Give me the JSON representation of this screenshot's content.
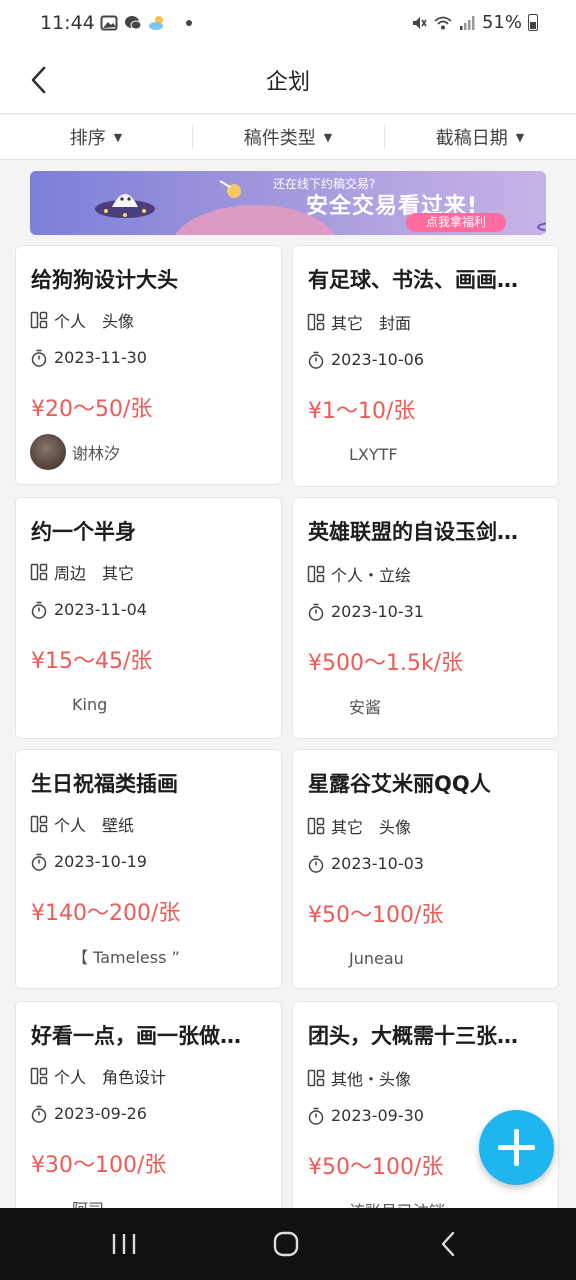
{
  "status_bar": {
    "time": "11:44",
    "battery": "51%",
    "icons": [
      "gallery-icon",
      "chat-icon",
      "weather-icon",
      "mute-icon",
      "wifi-icon",
      "signal-icon",
      "battery-icon"
    ]
  },
  "header": {
    "title": "企划",
    "back_icon": "chevron-left-icon"
  },
  "filters": [
    {
      "label": "排序"
    },
    {
      "label": "稿件类型"
    },
    {
      "label": "截稿日期"
    }
  ],
  "banner": {
    "line1": "还在线下约稿交易?",
    "line2": "安全交易看过来!",
    "cta": "点我拿福利"
  },
  "cards": [
    {
      "title": "给狗狗设计大头",
      "type1": "个人",
      "type2": "头像",
      "date": "2023-11-30",
      "price": "¥20～50/张",
      "author": "谢林汐",
      "has_avatar": true
    },
    {
      "title": "有足球、书法、画画…",
      "type1": "其它",
      "type2": "封面",
      "date": "2023-10-06",
      "price": "¥1～10/张",
      "author": "LXYTF",
      "has_avatar": false
    },
    {
      "title": "约一个半身",
      "type1": "周边",
      "type2": "其它",
      "date": "2023-11-04",
      "price": "¥15～45/张",
      "author": "King",
      "has_avatar": false
    },
    {
      "title": "英雄联盟的自设玉剑…",
      "type1": "个人・立绘",
      "type2": "",
      "date": "2023-10-31",
      "price": "¥500～1.5k/张",
      "author": "安酱",
      "has_avatar": false
    },
    {
      "title": "生日祝福类插画",
      "type1": "个人",
      "type2": "壁纸",
      "date": "2023-10-19",
      "price": "¥140～200/张",
      "author": "【 Tameless ”",
      "has_avatar": false
    },
    {
      "title": "星露谷艾米丽QQ人",
      "type1": "其它",
      "type2": "头像",
      "date": "2023-10-03",
      "price": "¥50～100/张",
      "author": "Juneau",
      "has_avatar": false
    },
    {
      "title": "好看一点，画一张做…",
      "type1": "个人",
      "type2": "角色设计",
      "date": "2023-09-26",
      "price": "¥30～100/张",
      "author": "阿司",
      "has_avatar": false
    },
    {
      "title": "团头，大概需十三张…",
      "type1": "其他・头像",
      "type2": "",
      "date": "2023-09-30",
      "price": "¥50～100/张",
      "author": "该账号已注销",
      "has_avatar": false
    }
  ],
  "fab": {
    "icon": "plus-icon"
  },
  "nav_bar": {
    "icons": [
      "recent-apps-icon",
      "home-icon",
      "back-icon"
    ]
  }
}
